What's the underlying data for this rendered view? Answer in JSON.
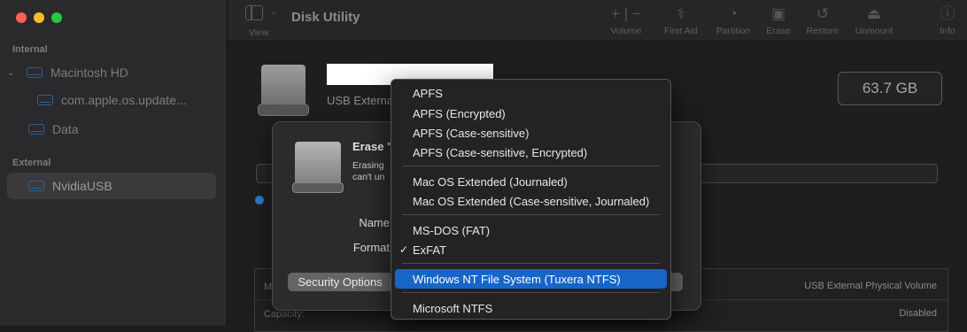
{
  "window": {
    "title": "Disk Utility"
  },
  "toolbar": {
    "view_label": "View",
    "buttons": [
      {
        "label": "Volume",
        "icon": "plus-minus-icon"
      },
      {
        "label": "First Aid",
        "icon": "stethoscope-icon"
      },
      {
        "label": "Partition",
        "icon": "pie-icon"
      },
      {
        "label": "Erase",
        "icon": "eraser-car-icon"
      },
      {
        "label": "Restore",
        "icon": "restore-arrow-icon"
      },
      {
        "label": "Unmount",
        "icon": "eject-icon"
      },
      {
        "label": "Info",
        "icon": "info-icon"
      }
    ]
  },
  "sidebar": {
    "internal_label": "Internal",
    "external_label": "External",
    "items": [
      {
        "label": "Macintosh HD"
      },
      {
        "label": "com.apple.os.update..."
      },
      {
        "label": "Data"
      },
      {
        "label": "NvidiaUSB"
      }
    ]
  },
  "main": {
    "subtitle": "USB Externa",
    "capacity": "63.7 GB",
    "info_rows": [
      {
        "left": "M",
        "right": "USB External Physical Volume"
      },
      {
        "left": "Capacity:",
        "right": "Disabled"
      }
    ]
  },
  "sheet": {
    "title": "Erase \"",
    "desc_line1": "Erasing",
    "desc_line2": "can't un",
    "name_label": "Name",
    "format_label": "Format",
    "security_button": "Security Options"
  },
  "format_menu": {
    "items": [
      {
        "label": "APFS",
        "checked": false
      },
      {
        "label": "APFS (Encrypted)",
        "checked": false
      },
      {
        "label": "APFS (Case-sensitive)",
        "checked": false
      },
      {
        "label": "APFS (Case-sensitive, Encrypted)",
        "checked": false
      },
      {
        "label": "Mac OS Extended (Journaled)",
        "checked": false
      },
      {
        "label": "Mac OS Extended (Case-sensitive, Journaled)",
        "checked": false
      },
      {
        "label": "MS-DOS (FAT)",
        "checked": false
      },
      {
        "label": "ExFAT",
        "checked": true
      },
      {
        "label": "Windows NT File System (Tuxera NTFS)",
        "checked": false,
        "highlighted": true
      },
      {
        "label": "Microsoft NTFS",
        "checked": false
      }
    ],
    "checkmark": "✓"
  },
  "colors": {
    "accent": "#1665c7",
    "traffic_red": "#ff5f57",
    "traffic_yellow": "#febc2e",
    "traffic_green": "#28c840"
  }
}
